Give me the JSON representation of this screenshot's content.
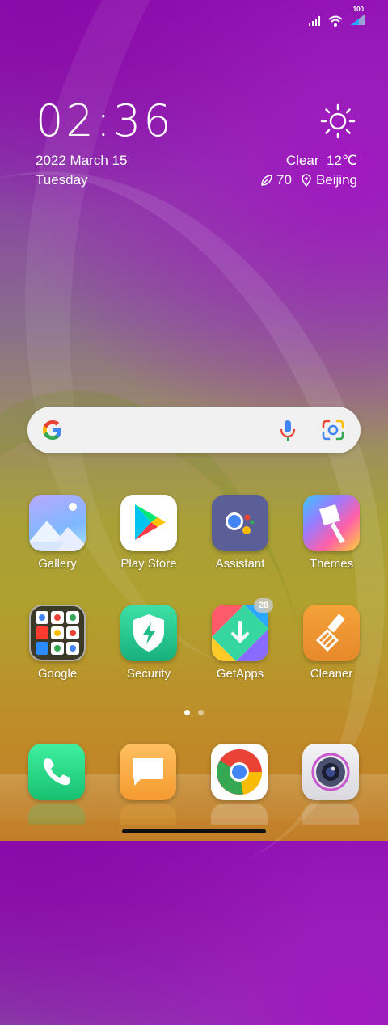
{
  "status": {
    "battery_text": "100",
    "icons": [
      "signal-icon",
      "wifi-icon",
      "battery-icon"
    ]
  },
  "clock": {
    "time": "02:36"
  },
  "date": {
    "date_text": "2022 March 15",
    "day_text": "Tuesday"
  },
  "weather": {
    "condition": "Clear",
    "temperature": "12℃",
    "aqi": "70",
    "location": "Beijing",
    "icon": "sun-icon"
  },
  "search": {
    "icons": [
      "google-g-icon",
      "microphone-icon",
      "google-lens-icon"
    ]
  },
  "apps_row1": [
    {
      "label": "Gallery",
      "icon": "gallery-icon"
    },
    {
      "label": "Play Store",
      "icon": "play-store-icon"
    },
    {
      "label": "Assistant",
      "icon": "assistant-icon"
    },
    {
      "label": "Themes",
      "icon": "themes-icon"
    }
  ],
  "apps_row2": [
    {
      "label": "Google",
      "icon": "google-folder-icon"
    },
    {
      "label": "Security",
      "icon": "security-icon"
    },
    {
      "label": "GetApps",
      "icon": "getapps-icon",
      "badge": "28"
    },
    {
      "label": "Cleaner",
      "icon": "cleaner-icon"
    }
  ],
  "pages": {
    "count": 2,
    "active": 1
  },
  "dock": [
    "phone-icon",
    "messages-icon",
    "chrome-icon",
    "camera-icon"
  ]
}
